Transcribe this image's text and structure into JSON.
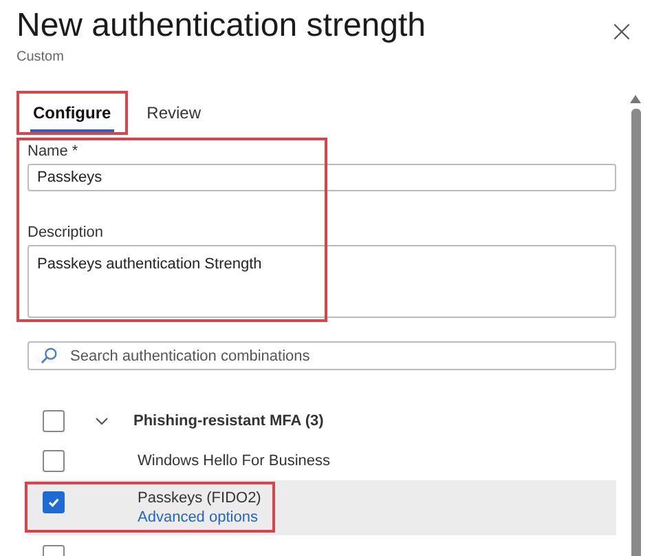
{
  "header": {
    "title": "New authentication strength",
    "subtitle": "Custom",
    "close": "×"
  },
  "tabs": [
    {
      "label": "Configure",
      "selected": true,
      "highlighted": true
    },
    {
      "label": "Review",
      "selected": false,
      "highlighted": false
    }
  ],
  "form": {
    "highlighted": true,
    "name_label": "Name *",
    "name_value": "Passkeys",
    "description_label": "Description",
    "description_value": "Passkeys authentication Strength"
  },
  "search": {
    "placeholder": "Search authentication combinations"
  },
  "items": [
    {
      "kind": "group",
      "label": "Phishing-resistant MFA (3)",
      "checked": false,
      "expanded": true,
      "selected": false,
      "highlighted": false
    },
    {
      "kind": "method",
      "label": "Windows Hello For Business",
      "checked": false,
      "selected": false,
      "highlighted": false
    },
    {
      "kind": "method",
      "label": "Passkeys (FIDO2)",
      "link": "Advanced options",
      "checked": true,
      "selected": true,
      "highlighted": true
    },
    {
      "kind": "method",
      "checked": false,
      "selected": false,
      "highlighted": false
    }
  ]
}
